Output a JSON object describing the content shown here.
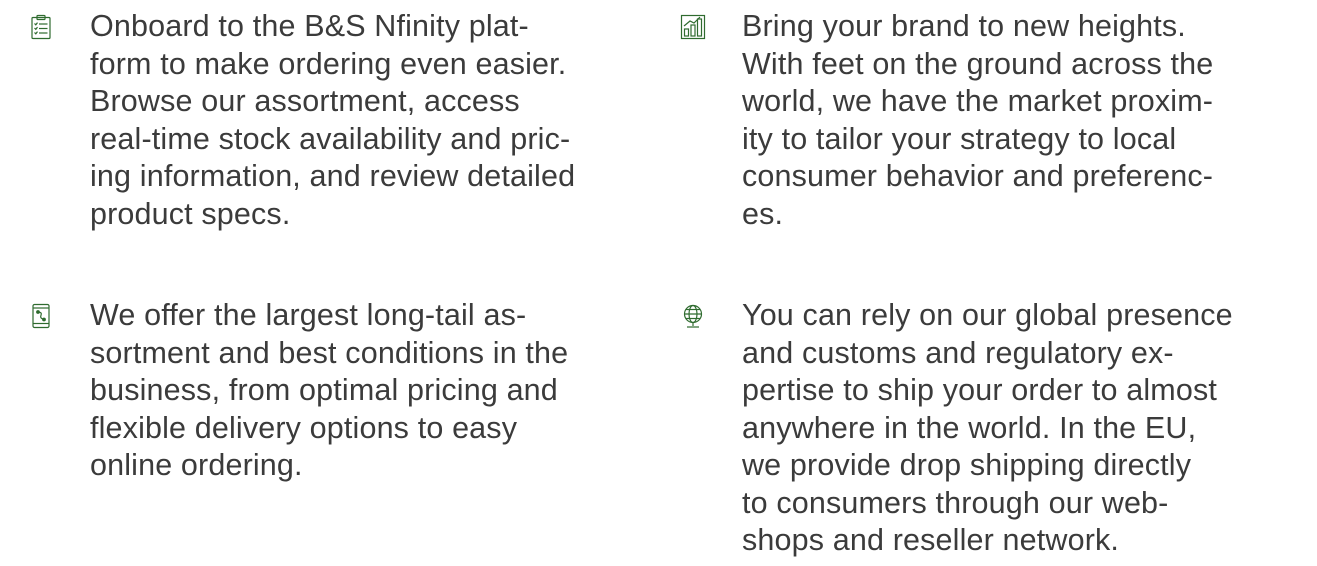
{
  "features": [
    {
      "icon": "clipboard-checklist-icon",
      "text": "Onboard to the B&S Nfinity plat-\nform to make ordering even easier.\nBrowse our assortment, access\nreal-time stock availability and pric-\ning information, and review detailed\nproduct specs."
    },
    {
      "icon": "growth-chart-icon",
      "text": "Bring your brand to new heights.\nWith feet on the ground across the\nworld, we have the market proxim-\nity to tailor your strategy to local\nconsumer behavior and preferenc-\nes."
    },
    {
      "icon": "mobile-route-icon",
      "text": "We offer the largest long-tail as-\nsortment and best conditions in the\nbusiness, from optimal pricing and\nflexible delivery options to easy\nonline ordering."
    },
    {
      "icon": "globe-icon",
      "text": "You can rely on our global presence\nand customs and regulatory ex-\npertise to ship your order to almost\nanywhere in the world. In the EU,\nwe provide drop shipping directly\nto consumers through our web-\nshops and reseller network."
    }
  ],
  "colors": {
    "accent": "#2f6b2f",
    "text": "#3b3b3b",
    "background": "#ffffff"
  }
}
